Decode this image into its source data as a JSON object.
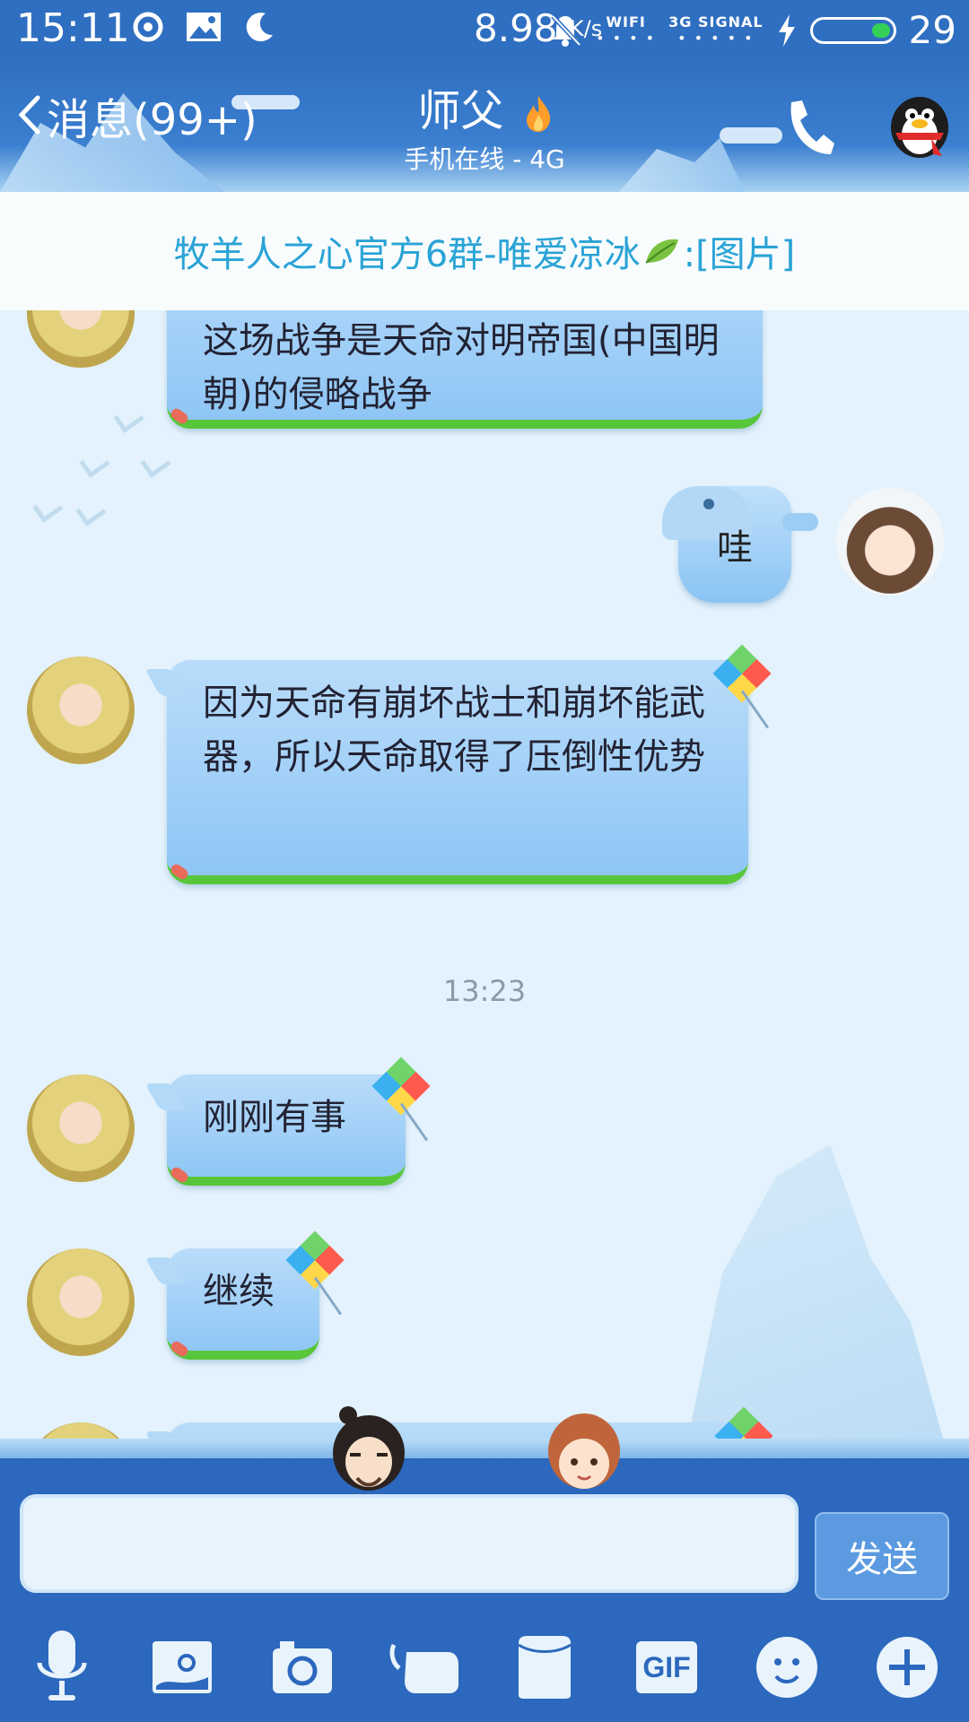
{
  "status_bar": {
    "time": "15:11",
    "net_speed": "8.98",
    "net_speed_unit": "K/s",
    "wifi_label": "WIFI",
    "signal_label": "3G SIGNAL",
    "battery": "29",
    "icons": [
      "netease-icon",
      "image-icon",
      "moon-icon",
      "mute-icon",
      "charging-icon"
    ]
  },
  "header": {
    "back_label": "消息(99+)",
    "title": "师父",
    "subtitle": "手机在线 - 4G",
    "icons": [
      "back-chevron-icon",
      "flame-icon",
      "phone-icon",
      "qq-penguin-icon"
    ]
  },
  "notice": {
    "text_before": "牧羊人之心官方6群-唯爱凉冰",
    "text_after": ":[图片]"
  },
  "messages": [
    {
      "side": "left",
      "text": "这场战争是天命对明帝国(中国明朝)的侵略战争"
    },
    {
      "side": "right",
      "text": "哇"
    },
    {
      "side": "left",
      "text": "因为天命有崩坏战士和崩坏能武器，所以天命取得了压倒性优势"
    },
    {
      "side": "left",
      "text": "刚刚有事"
    },
    {
      "side": "left",
      "text": "继续"
    }
  ],
  "time_separator": "13:23",
  "input": {
    "value": "",
    "send_label": "发送"
  },
  "toolbar": {
    "items": [
      "voice-icon",
      "picture-icon",
      "camera-icon",
      "hongbao-icon",
      "file-icon",
      "gif-icon",
      "emoji-icon",
      "plus-icon"
    ],
    "gif_label": "GIF"
  },
  "colors": {
    "header_blue": "#2f6fc1",
    "bubble_blue": "#9fcff7",
    "bubble_grass": "#58c63b",
    "notice_text": "#2aa3d6",
    "bottom_blue": "#2c68bd"
  }
}
